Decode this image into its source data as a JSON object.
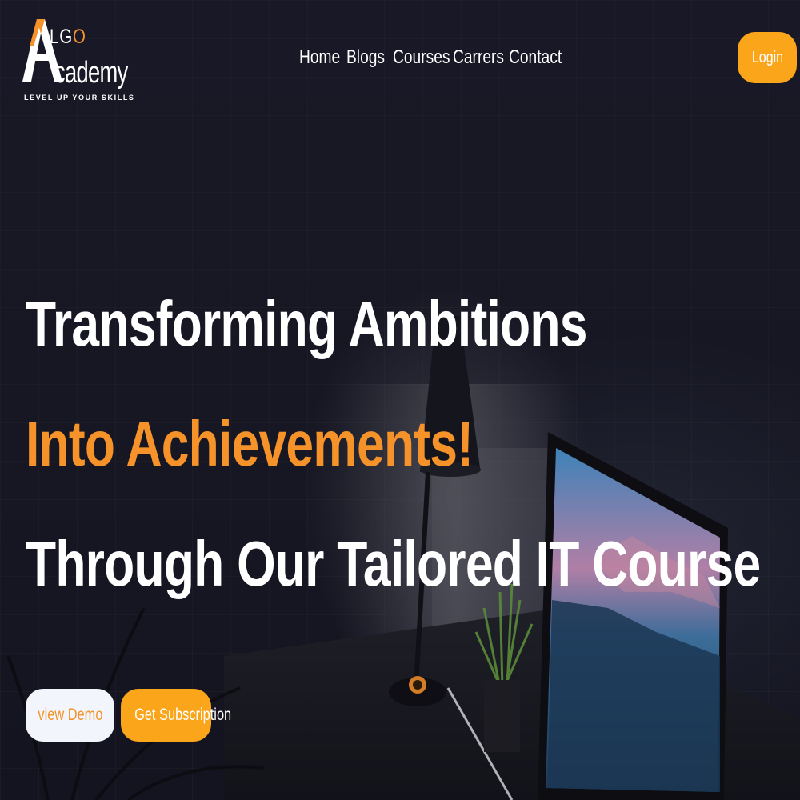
{
  "brand": {
    "logo_letter": "A",
    "logo_lgo_prefix": "LG",
    "logo_lgo_suffix": "O",
    "logo_academy": "cademy",
    "tagline": "LEVEL UP YOUR SKILLS",
    "accent_color": "#f6922a",
    "button_color": "#fba51a"
  },
  "nav": {
    "items": [
      {
        "label": "Home"
      },
      {
        "label": "Blogs"
      },
      {
        "label": "Courses"
      },
      {
        "label": "Carrers"
      },
      {
        "label": "Contact"
      }
    ],
    "login_label": "Login"
  },
  "hero": {
    "line1": "Transforming Ambitions",
    "line2": "Into Achievements!",
    "line3": "Through Our Tailored IT Course",
    "demo_label": "view Demo",
    "subscribe_label": "Get Subscription"
  }
}
